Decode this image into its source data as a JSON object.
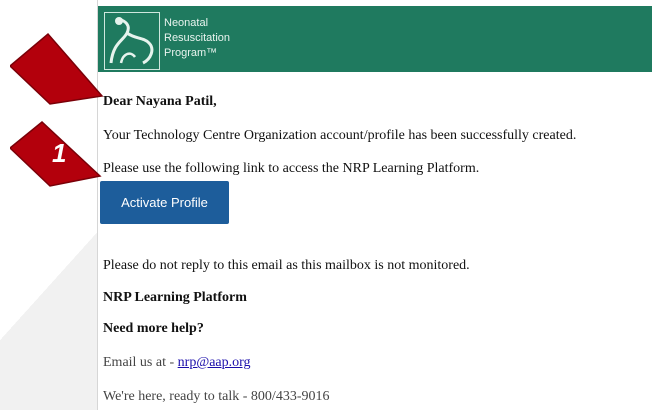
{
  "banner": {
    "logo_lines": [
      "Neonatal",
      "Resuscitation",
      "Program™"
    ],
    "bg_color": "#1f7a5f"
  },
  "email": {
    "greeting": "Dear Nayana Patil,",
    "line1": "Your Technology Centre Organization account/profile has been successfully created.",
    "line2": "Please use the following link to access the NRP Learning Platform.",
    "activate_label": "Activate Profile",
    "notice": "Please do not reply to this email as this mailbox is not monitored.",
    "signature": "NRP Learning Platform",
    "help_heading": "Need more help?",
    "email_prefix": "Email us at - ",
    "email_link": "nrp@aap.org",
    "phone_line": "We're here, ready to talk - 800/433-9016"
  },
  "annotations": {
    "step_number": "1",
    "arrow_color": "#b3000c"
  }
}
